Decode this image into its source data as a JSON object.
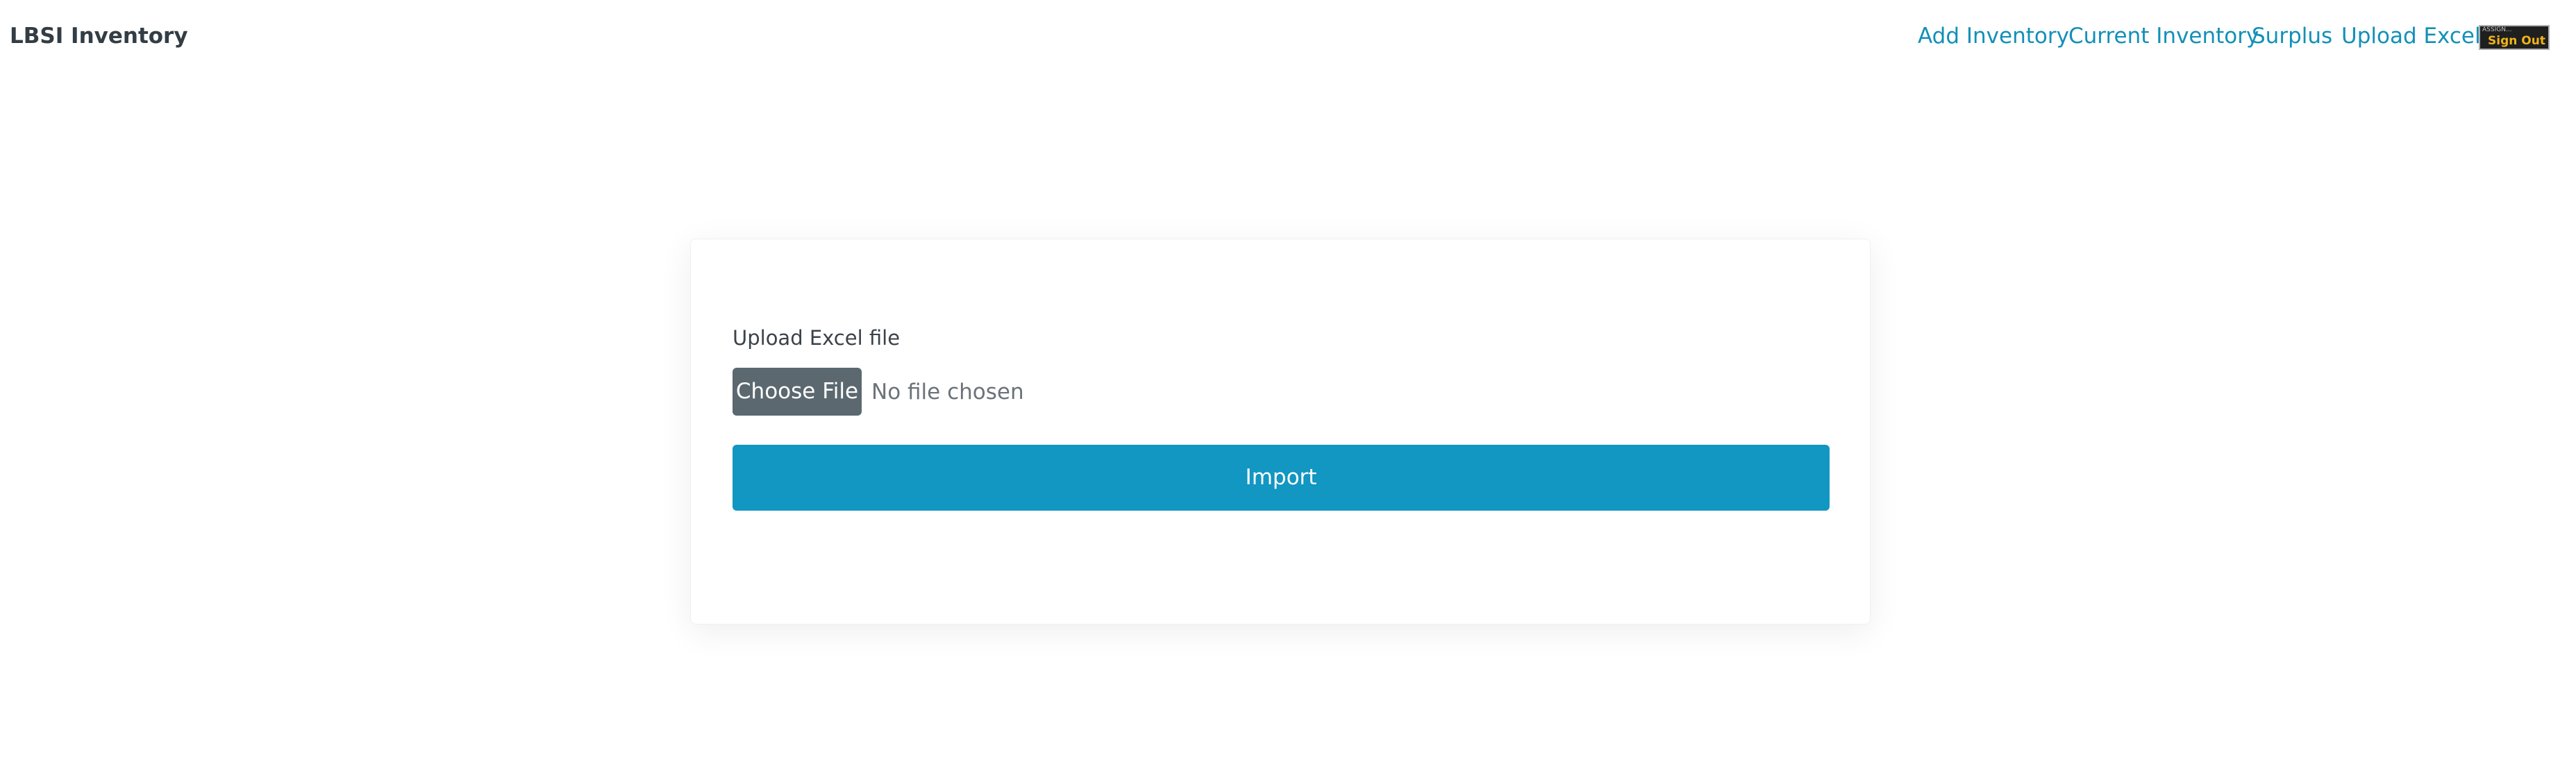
{
  "navbar": {
    "brand": "LBSI Inventory",
    "links": [
      {
        "label": "Add Inventory"
      },
      {
        "label": "Current Inventory"
      },
      {
        "label": "Surplus"
      },
      {
        "label": "Upload Excel"
      }
    ],
    "signout": {
      "small_text": "ASSIGN...",
      "label": "Sign Out"
    }
  },
  "form": {
    "label": "Upload Excel file",
    "choose_file_label": "Choose File",
    "file_status": "No file chosen",
    "import_label": "Import"
  },
  "colors": {
    "link": "#1290b7",
    "primary": "#1296c2",
    "secondary": "#5b6870"
  }
}
